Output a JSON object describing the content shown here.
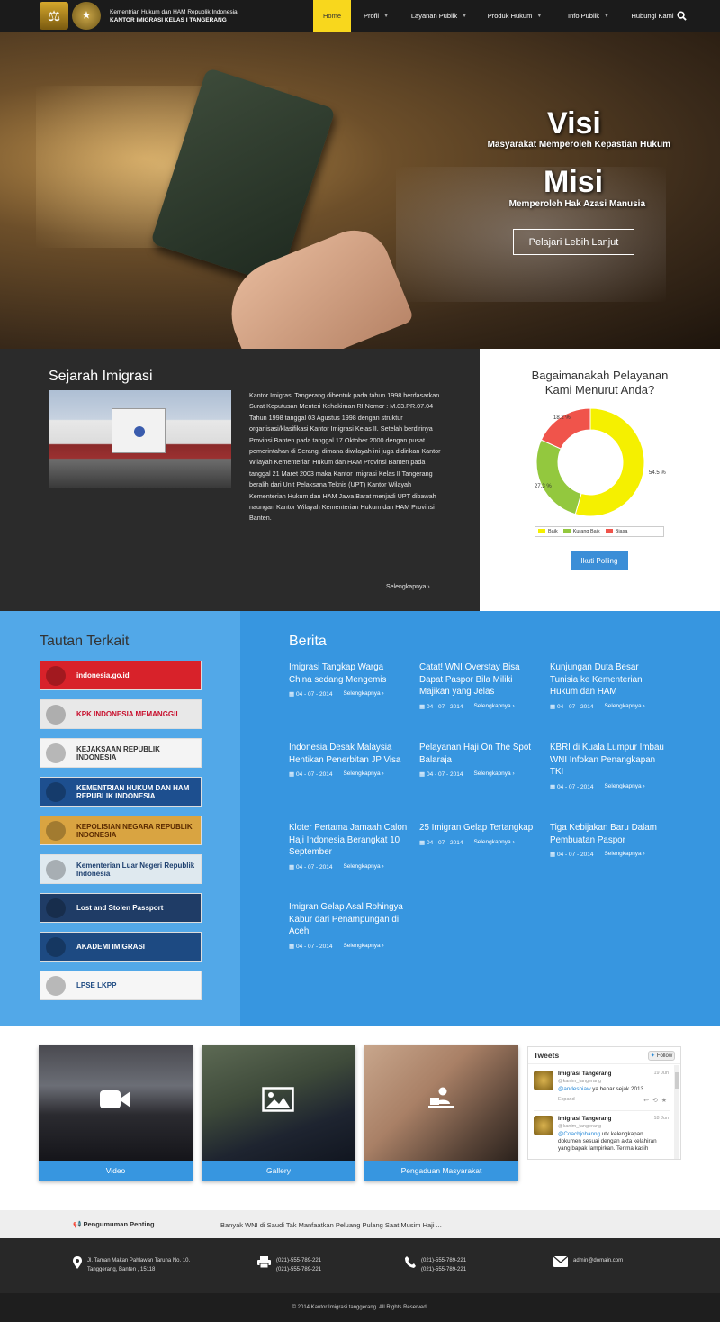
{
  "header": {
    "logo_label": "PENGAYOMAN",
    "brand_line1": "Kementrian Hukum dan HAM Republik Indonesia",
    "brand_line2": "KANTOR IMIGRASI KELAS I TANGERANG",
    "menu": [
      {
        "label": "Home",
        "active": true
      },
      {
        "label": "Profil",
        "dropdown": true
      },
      {
        "label": "Layanan Publik",
        "dropdown": true
      },
      {
        "label": "Produk Hukum",
        "dropdown": true
      },
      {
        "label": "Info Publik",
        "dropdown": true
      },
      {
        "label": "Hubungi Kami",
        "dropdown": false
      }
    ],
    "search_icon": "search-icon"
  },
  "hero": {
    "visi_title": "Visi",
    "visi_text": "Masyarakat Memperoleh Kepastian Hukum",
    "misi_title": "Misi",
    "misi_text": "Memperoleh Hak Azasi Manusia",
    "button_label": "Pelajari Lebih Lanjut"
  },
  "sejarah": {
    "title": "Sejarah Imigrasi",
    "text": "Kantor Imigrasi Tangerang dibentuk pada tahun 1998 berdasarkan Surat Keputusan Menteri Kehakiman RI Nomor : M.03.PR.07.04 Tahun 1998 tanggal 03 Agustus 1998 dengan struktur organisasi/klasifikasi Kantor Imigrasi Kelas II. Setelah berdirinya Provinsi Banten pada tanggal 17 Oktober 2000 dengan pusat pemerintahan di Serang, dimana diwilayah ini juga didirikan Kantor Wilayah Kementerian Hukum dan HAM Provinsi Banten pada tanggal 21 Maret 2003 maka Kantor Imigrasi Kelas II Tangerang beralih dari Unit Pelaksana Teknis (UPT) Kantor Wilayah Kementerian Hukum dan HAM Jawa Barat menjadi UPT dibawah naungan Kantor Wilayah Kementerian Hukum dan HAM Provinsi Banten.",
    "more_label": "Selengkapnya ›"
  },
  "poll": {
    "title_line1": "Bagaimanakah Pelayanan",
    "title_line2": "Kami Menurut Anda?",
    "button_label": "Ikuti Polling"
  },
  "chart_data": {
    "type": "pie",
    "donut": true,
    "categories": [
      "Baik",
      "Kurang Baik",
      "Biasa"
    ],
    "values": [
      54.5,
      27.3,
      18.2
    ],
    "labels": [
      "54.5 %",
      "27.3 %",
      "18.2 %"
    ],
    "colors": [
      "#f5f000",
      "#93c83e",
      "#f0544b"
    ],
    "legend_position": "bottom"
  },
  "tautan": {
    "title": "Tautan Terkait",
    "banners": [
      {
        "label": "indonesia.go.id",
        "bg": "#d8222a",
        "color": "#ffffff"
      },
      {
        "label": "KPK INDONESIA MEMANGGIL",
        "bg": "#e8e8e8",
        "color": "#c8102e"
      },
      {
        "label": "KEJAKSAAN REPUBLIK INDONESIA",
        "bg": "#f4f4f4",
        "color": "#333333"
      },
      {
        "label": "KEMENTRIAN HUKUM DAN HAM REPUBLIK INDONESIA",
        "bg": "#1d4f8f",
        "color": "#ffffff"
      },
      {
        "label": "KEPOLISIAN NEGARA REPUBLIK INDONESIA",
        "bg": "#d9a441",
        "color": "#5a2a00"
      },
      {
        "label": "Kementerian Luar Negeri Republik Indonesia",
        "bg": "#dfe9ef",
        "color": "#1d3f6e"
      },
      {
        "label": "Lost and Stolen Passport",
        "bg": "#1f3c66",
        "color": "#ffffff"
      },
      {
        "label": "AKADEMI IMIGRASI",
        "bg": "#1d4a82",
        "color": "#ffffff"
      },
      {
        "label": "LPSE LKPP",
        "bg": "#f6f6f6",
        "color": "#1d4a82"
      }
    ]
  },
  "berita": {
    "title": "Berita",
    "items": [
      {
        "title": "Imigrasi Tangkap Warga China sedang Mengemis",
        "date": "04 - 07 - 2014",
        "more": "Selengkapnya ›"
      },
      {
        "title": "Catat! WNI Overstay Bisa Dapat Paspor Bila Miliki Majikan yang Jelas",
        "date": "04 - 07 - 2014",
        "more": "Selengkapnya ›"
      },
      {
        "title": "Kunjungan Duta Besar Tunisia ke Kementerian Hukum dan HAM",
        "date": "04 - 07 - 2014",
        "more": "Selengkapnya ›"
      },
      {
        "title": "Indonesia Desak Malaysia Hentikan Penerbitan JP Visa",
        "date": "04 - 07 - 2014",
        "more": "Selengkapnya ›"
      },
      {
        "title": "Pelayanan Haji On The Spot Balaraja",
        "date": "04 - 07 - 2014",
        "more": "Selengkapnya ›"
      },
      {
        "title": "KBRI di Kuala Lumpur Imbau WNI Infokan Penangkapan TKI",
        "date": "04 - 07 - 2014",
        "more": "Selengkapnya ›"
      },
      {
        "title": "Kloter Pertama Jamaah Calon Haji Indonesia Berangkat 10 September",
        "date": "04 - 07 - 2014",
        "more": "Selengkapnya ›"
      },
      {
        "title": "25 Imigran Gelap Tertangkap",
        "date": "04 - 07 - 2014",
        "more": "Selengkapnya ›"
      },
      {
        "title": "Tiga Kebijakan Baru Dalam Pembuatan Paspor",
        "date": "04 - 07 - 2014",
        "more": "Selengkapnya ›"
      },
      {
        "title": "Imigran Gelap Asal Rohingya Kabur dari Penampungan di Aceh",
        "date": "04 - 07 - 2014",
        "more": "Selengkapnya ›"
      }
    ]
  },
  "media": {
    "cards": [
      {
        "label": "Video",
        "icon": "video-camera-icon"
      },
      {
        "label": "Gallery",
        "icon": "image-icon"
      },
      {
        "label": "Pengaduan Masyarakat",
        "icon": "user-laptop-icon"
      }
    ]
  },
  "tweets": {
    "title": "Tweets",
    "follow_label": "Follow",
    "items": [
      {
        "name": "Imigrasi Tangerang",
        "handle": "@kanim_tangerang",
        "date": "19 Jun",
        "mention": "@andeshiaw",
        "text": " ya benar sejak 2013",
        "expand": "Expand"
      },
      {
        "name": "Imigrasi Tangerang",
        "handle": "@kanim_tangerang",
        "date": "18 Jun",
        "mention": "@Coachjohanng",
        "text": " utk kelengkapan dokumen sesuai dengan akta kelahiran yang bapak lampirkan. Terima kasih"
      }
    ]
  },
  "announcement": {
    "label": "Pengumuman Penting",
    "text": "Banyak WNI di Saudi Tak Manfaatkan Peluang Pulang Saat Musim Haji ..."
  },
  "footer": {
    "address_line1": "Jl. Taman Makan Pahlawan Taruna No. 10.",
    "address_line2": "Tanggerang, Banten , 15118",
    "fax_line1": "(021)-555-789-221",
    "fax_line2": "(021)-555-789-221",
    "phone_line1": "(021)-555-789-221",
    "phone_line2": "(021)-555-789-221",
    "email": "admin@domain.com",
    "copyright": "© 2014 Kantor Imigrasi tanggerang. All Rights Reserved."
  }
}
